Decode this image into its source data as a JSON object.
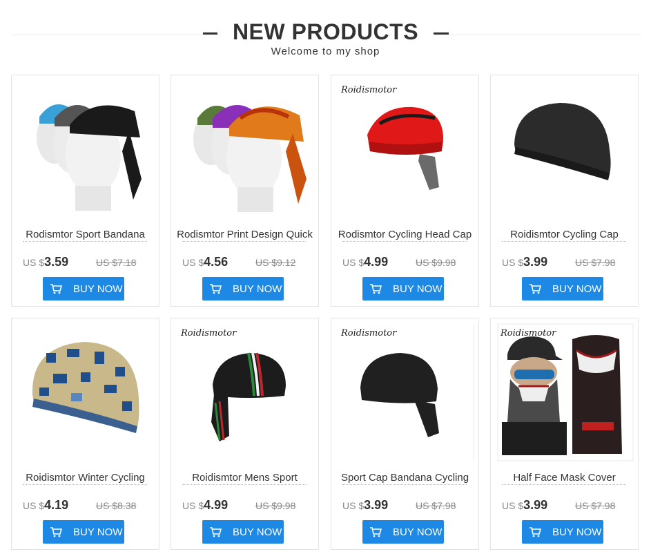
{
  "header": {
    "title": "NEW PRODUCTS",
    "subtitle": "Welcome to my shop"
  },
  "buy_label": "BUY NOW",
  "products": [
    {
      "name": "Rodismtor Sport Bandana",
      "currency": "US $",
      "price": "3.59",
      "old_price": "US $7.18",
      "brand": ""
    },
    {
      "name": "Rodismtor Print Design Quick",
      "currency": "US $",
      "price": "4.56",
      "old_price": "US $9.12",
      "brand": ""
    },
    {
      "name": "Rodismtor Cycling Head Cap",
      "currency": "US $",
      "price": "4.99",
      "old_price": "US $9.98",
      "brand": "Roidismotor"
    },
    {
      "name": "Roidismtor Cycling Cap",
      "currency": "US $",
      "price": "3.99",
      "old_price": "US $7.98",
      "brand": ""
    },
    {
      "name": "Roidismtor Winter Cycling",
      "currency": "US $",
      "price": "4.19",
      "old_price": "US $8.38",
      "brand": ""
    },
    {
      "name": "Roidismtor Mens Sport",
      "currency": "US $",
      "price": "4.99",
      "old_price": "US $9.98",
      "brand": "Roidismotor"
    },
    {
      "name": "Sport Cap Bandana Cycling",
      "currency": "US $",
      "price": "3.99",
      "old_price": "US $7.98",
      "brand": "Roidismotor"
    },
    {
      "name": "Half Face Mask Cover",
      "currency": "US $",
      "price": "3.99",
      "old_price": "US $7.98",
      "brand": "Roidismotor"
    }
  ],
  "colors": {
    "accent": "#1e88e5",
    "text": "#333333",
    "muted": "#888888",
    "border": "#e4e4e4"
  }
}
